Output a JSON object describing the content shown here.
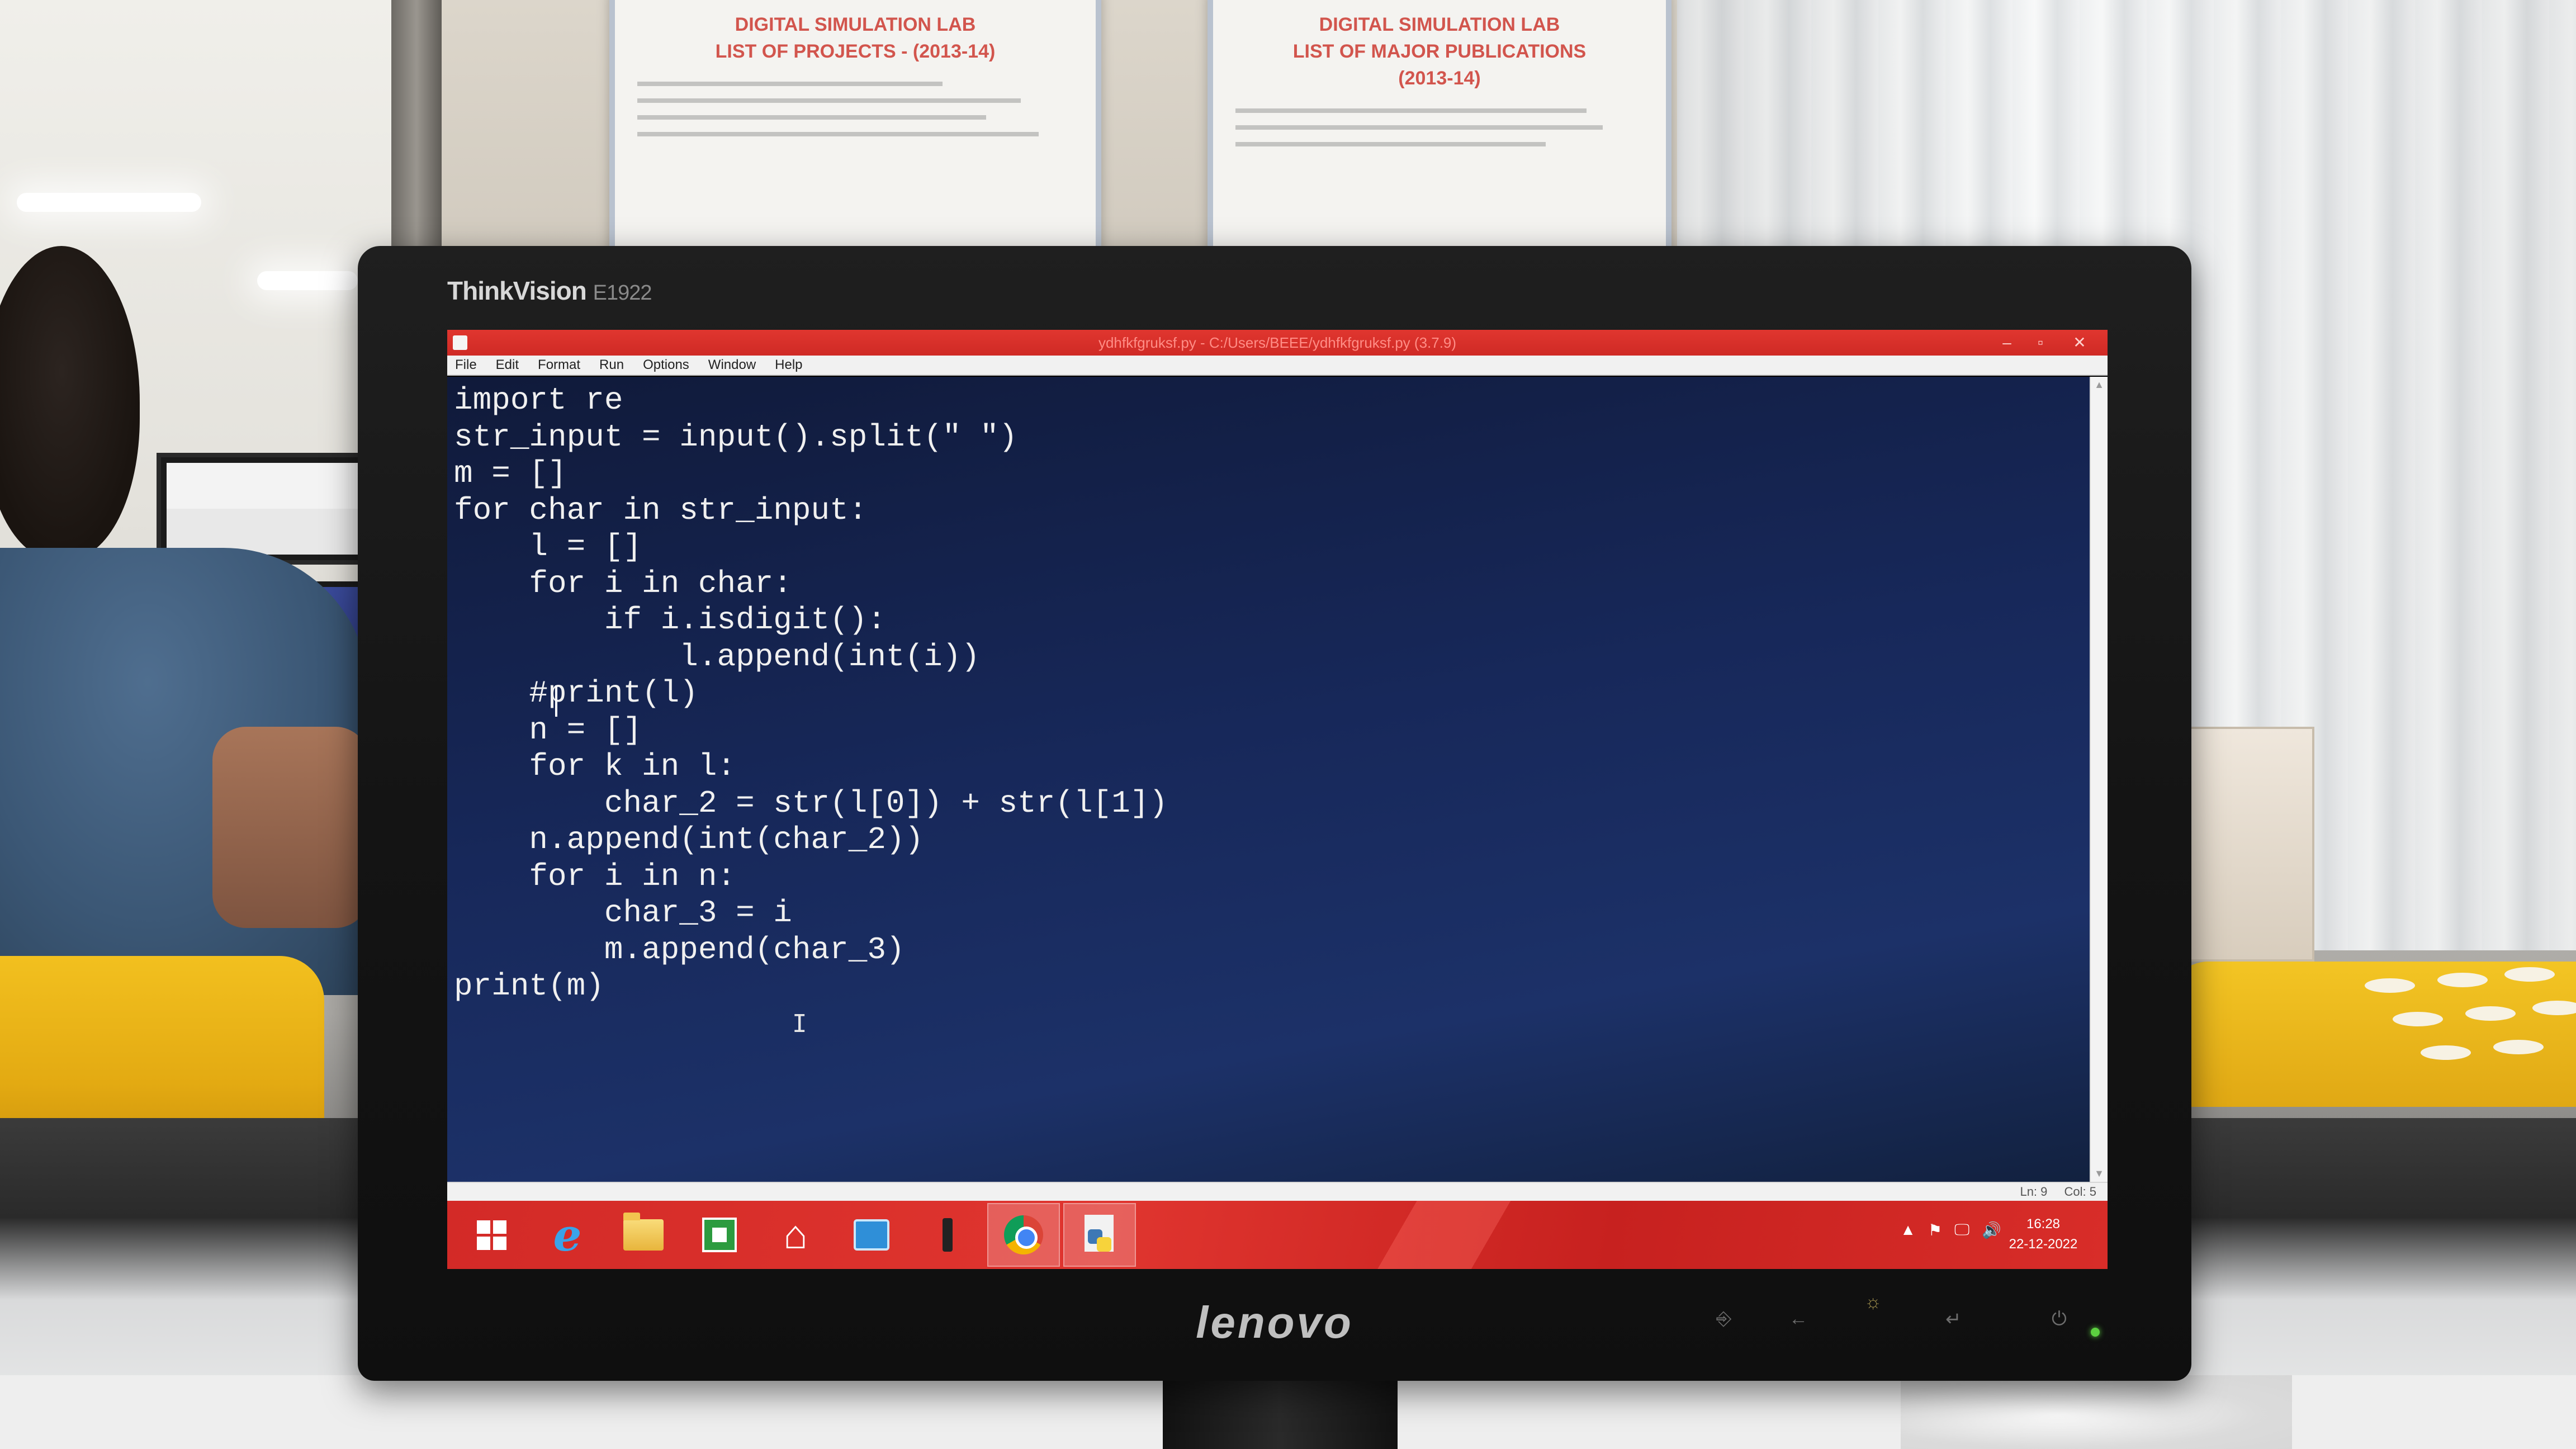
{
  "posters": [
    {
      "title_line1": "DIGITAL SIMULATION LAB",
      "title_line2": "LIST OF PROJECTS - (2013-14)"
    },
    {
      "title_line1": "DIGITAL SIMULATION LAB",
      "title_line2": "LIST OF MAJOR PUBLICATIONS",
      "title_line3": "(2013-14)"
    }
  ],
  "monitor": {
    "brand": "ThinkVision",
    "model": "E1922",
    "maker": "lenovo"
  },
  "window": {
    "title": "ydhfkfgruksf.py - C:/Users/BEEE/ydhfkfgruksf.py (3.7.9)",
    "minimize": "–",
    "maximize": "▫",
    "close": "✕"
  },
  "menu": [
    "File",
    "Edit",
    "Format",
    "Run",
    "Options",
    "Window",
    "Help"
  ],
  "code_lines": [
    "import re",
    "str_input = input().split(\" \")",
    "m = []",
    "for char in str_input:",
    "    l = []",
    "    for i in char:",
    "        if i.isdigit():",
    "            l.append(int(i))",
    "    #print(l)",
    "    n = []",
    "    for k in l:",
    "        char_2 = str(l[0]) + str(l[1])",
    "    n.append(int(char_2))",
    "    for i in n:",
    "        char_3 = i",
    "        m.append(char_3)",
    "print(m)"
  ],
  "status": {
    "line": "Ln: 9",
    "col": "Col: 5"
  },
  "taskbar": {
    "items": [
      "start",
      "internet-explorer",
      "file-explorer",
      "store",
      "home",
      "mail",
      "usb-drive",
      "chrome",
      "python-idle"
    ],
    "tray_icons": [
      "▲",
      "⚑",
      "🖵",
      "🔊"
    ],
    "time": "16:28",
    "date": "22-12-2022"
  }
}
